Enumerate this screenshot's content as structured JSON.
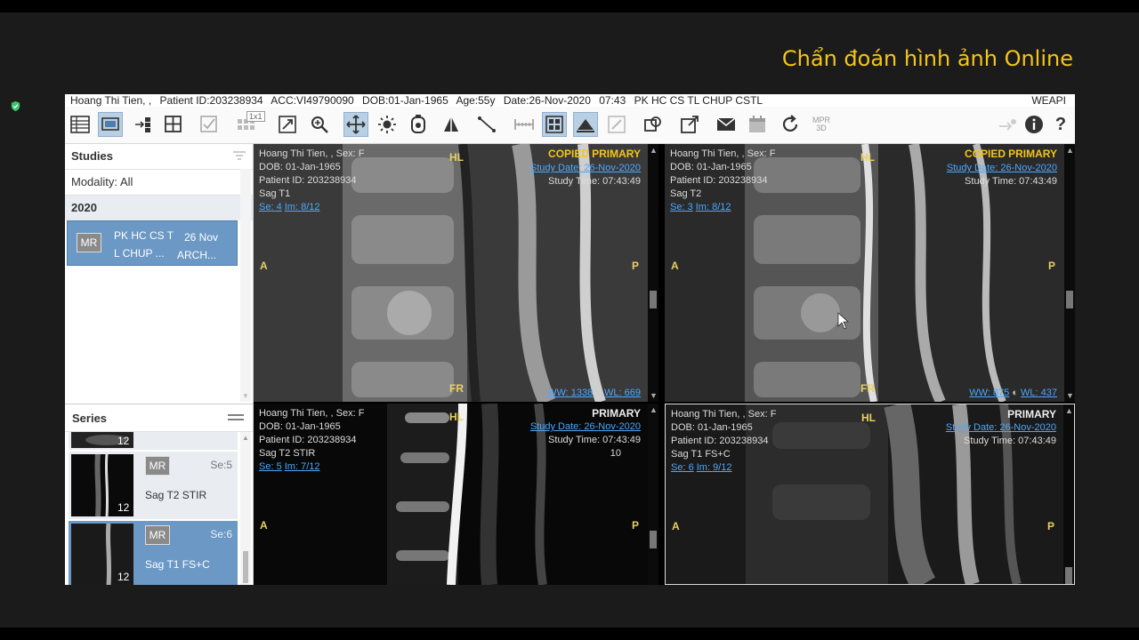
{
  "brand": "Chẩn đoán hình ảnh Online",
  "infobar": {
    "patient": "Hoang Thi Tien, ,",
    "patient_id": "Patient ID:203238934",
    "acc": "ACC:VI49790090",
    "dob": "DOB:01-Jan-1965",
    "age": "Age:55y",
    "date": "Date:26-Nov-2020",
    "time": "07:43",
    "desc": "PK HC CS TL CHUP CSTL",
    "right": "WEAPI"
  },
  "toolbar": {
    "icons": [
      "worklist-icon",
      "monitor-layout-icon",
      "series-sync-icon",
      "grid-layout-icon",
      "check-layout-icon",
      "one-by-one-layout-icon",
      "pan-link-icon",
      "zoom-icon",
      "move-icon",
      "brightness-icon",
      "timer-icon",
      "rotate-icon",
      "measure-line-icon",
      "ruler-icon",
      "overlay-icon",
      "cine-icon",
      "edit-icon",
      "copy-icon",
      "export-icon",
      "mail-icon",
      "calendar-icon",
      "refresh-icon",
      "mpr-3d-icon",
      "arrow-tool-icon",
      "info-icon",
      "help-icon"
    ],
    "layout_badge": "1x1",
    "mpr_label_1": "MPR",
    "mpr_label_2": "3D"
  },
  "studies": {
    "title": "Studies",
    "modality_label": "Modality:",
    "modality_value": "All",
    "year": "2020",
    "item": {
      "modality": "MR",
      "desc_line1": "PK HC CS T",
      "desc_line2": "L CHUP ...",
      "date": "26 Nov",
      "status": "ARCH..."
    }
  },
  "series": {
    "title": "Series",
    "items": [
      {
        "count": "12"
      },
      {
        "modality": "MR",
        "se": "Se:5",
        "name": "Sag T2 STIR",
        "count": "12"
      },
      {
        "modality": "MR",
        "se": "Se:6",
        "name": "Sag T1 FS+C",
        "count": "12"
      }
    ]
  },
  "viewports": [
    {
      "patient": "Hoang Thi Tien, , Sex: F",
      "dob": "DOB: 01-Jan-1965",
      "pid": "Patient ID: 203238934",
      "seq": "Sag T1",
      "se": "Se: 4",
      "im": "Im: 8/12",
      "tag_copied": "COPIED",
      "tag_primary": "PRIMARY",
      "study_date": "Study Date: 26-Nov-2020",
      "study_time": "Study Time: 07:43:49",
      "ww": "WW: 1338",
      "wl": "WL: 669",
      "top": "HL",
      "bottom": "FR",
      "left": "A",
      "right": "P",
      "extra": ""
    },
    {
      "patient": "Hoang Thi Tien, , Sex: F",
      "dob": "DOB: 01-Jan-1965",
      "pid": "Patient ID: 203238934",
      "seq": "Sag T2",
      "se": "Se: 3",
      "im": "Im: 8/12",
      "tag_copied": "COPIED",
      "tag_primary": "PRIMARY",
      "study_date": "Study Date: 26-Nov-2020",
      "study_time": "Study Time: 07:43:49",
      "ww": "WW: 875",
      "wl": "WL: 437",
      "top": "HL",
      "bottom": "FR",
      "left": "A",
      "right": "P",
      "extra": ""
    },
    {
      "patient": "Hoang Thi Tien, , Sex: F",
      "dob": "DOB: 01-Jan-1965",
      "pid": "Patient ID: 203238934",
      "seq": "Sag T2 STIR",
      "se": "Se: 5",
      "im": "Im: 7/12",
      "tag_copied": "",
      "tag_primary": "PRIMARY",
      "study_date": "Study Date: 26-Nov-2020",
      "study_time": "Study Time: 07:43:49",
      "ww": "",
      "wl": "",
      "top": "HL",
      "bottom": "",
      "left": "A",
      "right": "P",
      "extra": "10"
    },
    {
      "patient": "Hoang Thi Tien, , Sex: F",
      "dob": "DOB: 01-Jan-1965",
      "pid": "Patient ID: 203238934",
      "seq": "Sag T1 FS+C",
      "se": "Se: 6",
      "im": "Im: 9/12",
      "tag_copied": "",
      "tag_primary": "PRIMARY",
      "study_date": "Study Date: 26-Nov-2020",
      "study_time": "Study Time: 07:43:49",
      "ww": "",
      "wl": "",
      "top": "HL",
      "bottom": "",
      "left": "A",
      "right": "P",
      "extra": ""
    }
  ]
}
